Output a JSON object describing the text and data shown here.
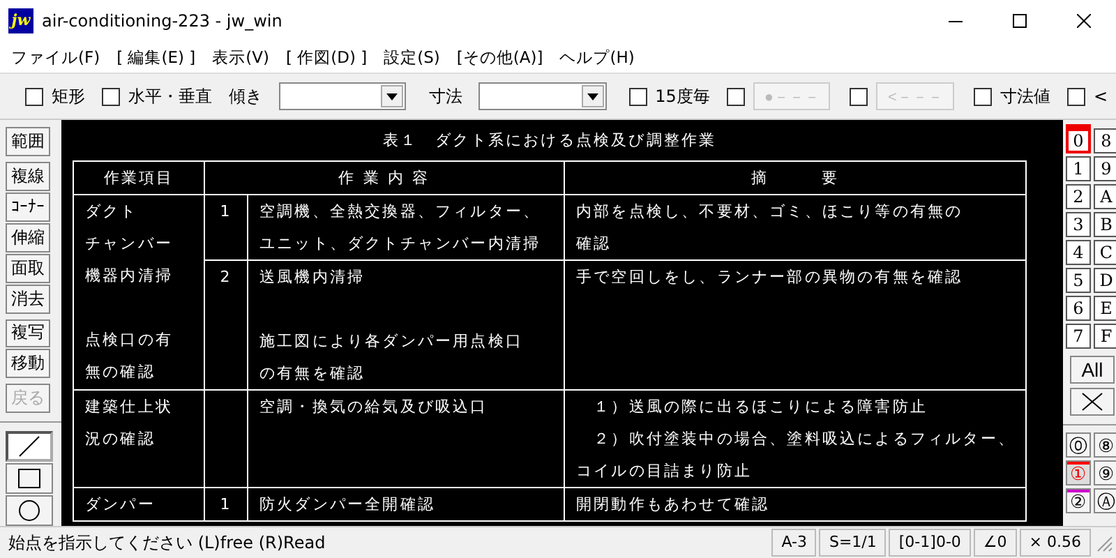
{
  "window": {
    "title": "air-conditioning-223 - jw_win",
    "app_icon": "jw"
  },
  "menu": [
    {
      "label": "ファイル(F)"
    },
    {
      "label": "[ 編集(E) ]"
    },
    {
      "label": "表示(V)"
    },
    {
      "label": "[ 作図(D) ]"
    },
    {
      "label": "設定(S)"
    },
    {
      "label": "[その他(A)]"
    },
    {
      "label": "ヘルプ(H)"
    }
  ],
  "toolbar": [
    {
      "kind": "checkbox",
      "label": "矩形",
      "checked": false
    },
    {
      "kind": "checkbox",
      "label": "水平・垂直",
      "checked": false
    },
    {
      "kind": "dropdown",
      "label": "傾き"
    },
    {
      "kind": "dropdown",
      "label": "寸法"
    },
    {
      "kind": "checkbox",
      "label": "15度毎",
      "checked": false
    },
    {
      "kind": "checkbutton",
      "label": "●－－－",
      "checked": false,
      "disabled": true
    },
    {
      "kind": "checkbutton",
      "label": "<－－－",
      "checked": false,
      "disabled": true
    },
    {
      "kind": "checkbox",
      "label": "寸法値",
      "checked": false
    },
    {
      "kind": "checkbox",
      "label": "<",
      "checked": false
    }
  ],
  "left_tools": [
    {
      "label": "範囲",
      "disabled": false,
      "group_start": false
    },
    {
      "label": "複線",
      "disabled": false,
      "group_start": true
    },
    {
      "label": "ｺｰﾅｰ",
      "disabled": false,
      "group_start": false
    },
    {
      "label": "伸縮",
      "disabled": false,
      "group_start": false
    },
    {
      "label": "面取",
      "disabled": false,
      "group_start": false
    },
    {
      "label": "消去",
      "disabled": false,
      "group_start": false
    },
    {
      "label": "複写",
      "disabled": false,
      "group_start": true
    },
    {
      "label": "移動",
      "disabled": false,
      "group_start": false
    },
    {
      "label": "戻る",
      "disabled": true,
      "group_start": true
    }
  ],
  "draw_tools": [
    {
      "kind": "line",
      "selected": true
    },
    {
      "kind": "rectangle",
      "selected": false
    },
    {
      "kind": "circle",
      "selected": false
    }
  ],
  "drawing": {
    "title": "表１　ダクト系における点検及び調整作業",
    "columns": [
      "作業項目",
      "作 業 内 容",
      "摘　　　要"
    ],
    "groups": [
      {
        "item": [
          [
            "ダクト",
            "チャンバー",
            "機器内清掃"
          ],
          [
            "点検口の有",
            "無の確認"
          ]
        ],
        "steps": [
          {
            "number": "1",
            "content": [
              [
                "空調機、全熱交換器、フィルター、",
                "ユニット、ダクトチャンバー内清掃"
              ]
            ],
            "note": [
              [
                "内部を点検し、不要材、ゴミ、ほこり等の有無の",
                "確認"
              ]
            ]
          },
          {
            "number": "2",
            "content": [
              [
                "送風機内清掃"
              ],
              [
                "施工図により各ダンパー用点検口",
                "の有無を確認"
              ]
            ],
            "note": [
              [
                "手で空回しをし、ランナー部の異物の有無を確認"
              ]
            ]
          }
        ]
      },
      {
        "item": [
          [
            "建築仕上状",
            "況の確認"
          ]
        ],
        "steps": [
          {
            "content": [
              [
                "空調・換気の給気及び吸込口"
              ]
            ],
            "note": [
              [
                "　１）送風の際に出るほこりによる障害防止",
                "　２）吹付塗装中の場合、塗料吸込によるフィルター、",
                "コイルの目詰まり防止"
              ]
            ]
          }
        ]
      },
      {
        "item": [
          [
            "ダンパー"
          ]
        ],
        "steps": [
          {
            "number": "1",
            "content": [
              [
                "防火ダンパー全開確認"
              ]
            ],
            "note": [
              [
                "開閉動作もあわせて確認"
              ]
            ]
          }
        ]
      }
    ]
  },
  "layers": [
    {
      "label": "0",
      "selected": true
    },
    {
      "label": "8",
      "selected": false
    },
    {
      "label": "1",
      "selected": false
    },
    {
      "label": "9",
      "selected": false
    },
    {
      "label": "2",
      "selected": false
    },
    {
      "label": "A",
      "selected": false
    },
    {
      "label": "3",
      "selected": false
    },
    {
      "label": "B",
      "selected": false
    },
    {
      "label": "4",
      "selected": false
    },
    {
      "label": "C",
      "selected": false
    },
    {
      "label": "5",
      "selected": false
    },
    {
      "label": "D",
      "selected": false
    },
    {
      "label": "6",
      "selected": false
    },
    {
      "label": "E",
      "selected": false
    },
    {
      "label": "7",
      "selected": false
    },
    {
      "label": "F",
      "selected": false
    }
  ],
  "layer_all": "All",
  "layer_groups": [
    {
      "label": "⓪",
      "selected": false
    },
    {
      "label": "⑧",
      "selected": false
    },
    {
      "label": "①",
      "selected": true,
      "color": "#ff0000"
    },
    {
      "label": "⑨",
      "selected": false
    },
    {
      "label": "②",
      "selected": false,
      "color": "#cc00cc"
    },
    {
      "label": "Ⓐ",
      "selected": false
    }
  ],
  "status_bar": {
    "message": "始点を指示してください (L)free (R)Read",
    "fields": [
      "A-3",
      "S=1/1",
      "[0-1]0-0",
      "∠0",
      "× 0.56"
    ]
  }
}
